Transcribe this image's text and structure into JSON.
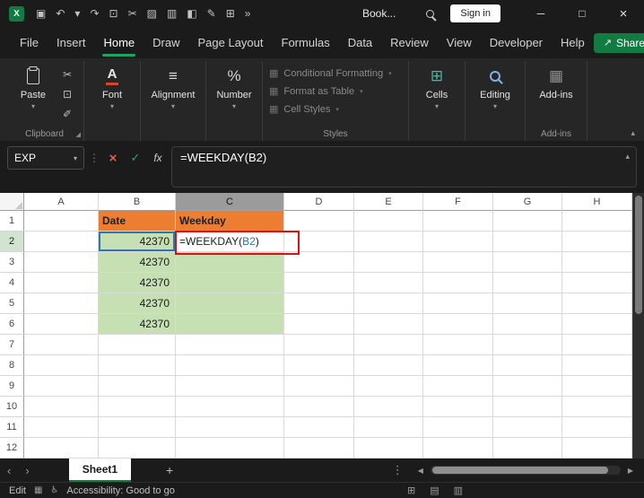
{
  "titlebar": {
    "logo_letter": "X",
    "quick_access_icons": [
      "save-icon",
      "undo-icon",
      "undo-chevron-icon",
      "redo-icon",
      "copy-icon",
      "cut-icon",
      "picture-icon",
      "chart-icon",
      "fill-color-icon",
      "pen-icon",
      "table-icon",
      "overflow-icon"
    ],
    "title": "Book...",
    "signin_label": "Sign in",
    "window_controls": [
      "minimize-button",
      "maximize-button",
      "close-button"
    ]
  },
  "menubar": {
    "items": [
      "File",
      "Insert",
      "Home",
      "Draw",
      "Page Layout",
      "Formulas",
      "Data",
      "Review",
      "View",
      "Developer",
      "Help"
    ],
    "active": "Home",
    "share_label": "Share"
  },
  "ribbon": {
    "paste_label": "Paste",
    "clipboard_group_label": "Clipboard",
    "font_label": "Font",
    "alignment_label": "Alignment",
    "number_label": "Number",
    "styles_items": [
      "Conditional Formatting",
      "Format as Table",
      "Cell Styles"
    ],
    "styles_group_label": "Styles",
    "cells_label": "Cells",
    "editing_label": "Editing",
    "addins_label": "Add-ins",
    "addins_group_label": "Add-ins"
  },
  "formula_bar": {
    "name_box_value": "EXP",
    "fx_label": "fx",
    "formula": "=WEEKDAY(B2)"
  },
  "sheet": {
    "columns": [
      "A",
      "B",
      "C",
      "D",
      "E",
      "F",
      "G",
      "H"
    ],
    "num_rows": 12,
    "selected_column": "C",
    "selected_row": 2,
    "cells": {
      "B1": {
        "text": "Date",
        "style": "orange"
      },
      "C1": {
        "text": "Weekday",
        "style": "orange"
      },
      "B2": {
        "text": "42370",
        "style": "green num ref"
      },
      "C2": {
        "style": "editing annot",
        "parts": [
          {
            "text": "=WEEKDAY(",
            "color": "#1f1f1f"
          },
          {
            "text": "B2",
            "color": "#2e75b6"
          },
          {
            "text": ")",
            "color": "#1f1f1f"
          }
        ]
      },
      "B3": {
        "text": "42370",
        "style": "green num"
      },
      "C3": {
        "style": "green"
      },
      "B4": {
        "text": "42370",
        "style": "green num"
      },
      "C4": {
        "style": "green"
      },
      "B5": {
        "text": "42370",
        "style": "green num"
      },
      "C5": {
        "style": "green"
      },
      "B6": {
        "text": "42370",
        "style": "green num"
      },
      "C6": {
        "style": "green"
      }
    }
  },
  "tabbar": {
    "active_tab": "Sheet1",
    "add_label": "+"
  },
  "statusbar": {
    "mode": "Edit",
    "accessibility": "Accessibility: Good to go",
    "view_icons": [
      "normal-view-icon",
      "page-layout-view-icon",
      "page-break-view-icon"
    ]
  },
  "colors": {
    "accent_green": "#107C41",
    "header_orange": "#ED7D31",
    "cell_green": "#C6E0B4",
    "reference_blue": "#2E75B6",
    "annotation_red": "#E01010"
  }
}
